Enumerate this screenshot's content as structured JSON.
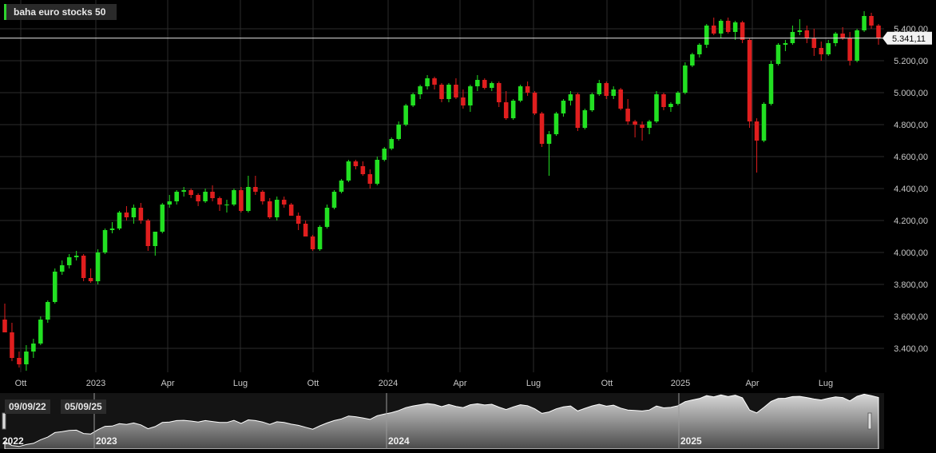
{
  "chart_data": {
    "type": "candlestick",
    "legend": "baha euro stocks 50",
    "last_price": 5341.11,
    "last_price_label": "5.341,11",
    "y_ticks": [
      "3.400,00",
      "3.600,00",
      "3.800,00",
      "4.000,00",
      "4.200,00",
      "4.400,00",
      "4.600,00",
      "4.800,00",
      "5.000,00",
      "5.200,00",
      "5.400,00"
    ],
    "x_ticks": [
      "Ott",
      "2023",
      "Apr",
      "Lug",
      "Ott",
      "2024",
      "Apr",
      "Lug",
      "Ott",
      "2025",
      "Apr",
      "Lug"
    ],
    "ylim": [
      3260,
      5460
    ],
    "colors": {
      "up": "#22e022",
      "down": "#e01e1e",
      "grid": "#2c2c2c",
      "last_line": "#e8e8e8",
      "nav_fill": "#8c8c8c"
    },
    "candles": [
      [
        3580,
        3680,
        3520,
        3500
      ],
      [
        3500,
        3560,
        3320,
        3340
      ],
      [
        3340,
        3380,
        3280,
        3300
      ],
      [
        3300,
        3420,
        3260,
        3380
      ],
      [
        3380,
        3460,
        3340,
        3430
      ],
      [
        3430,
        3600,
        3420,
        3580
      ],
      [
        3580,
        3700,
        3560,
        3690
      ],
      [
        3690,
        3900,
        3680,
        3880
      ],
      [
        3880,
        3950,
        3860,
        3920
      ],
      [
        3920,
        3990,
        3900,
        3970
      ],
      [
        3970,
        4010,
        3950,
        3980
      ],
      [
        3980,
        3990,
        3820,
        3840
      ],
      [
        3840,
        3900,
        3810,
        3820
      ],
      [
        3820,
        4020,
        3800,
        4000
      ],
      [
        4000,
        4150,
        3990,
        4140
      ],
      [
        4140,
        4190,
        4120,
        4150
      ],
      [
        4150,
        4260,
        4140,
        4250
      ],
      [
        4250,
        4290,
        4200,
        4220
      ],
      [
        4220,
        4300,
        4180,
        4280
      ],
      [
        4280,
        4310,
        4180,
        4200
      ],
      [
        4200,
        4210,
        4010,
        4040
      ],
      [
        4040,
        4130,
        3980,
        4130
      ],
      [
        4130,
        4310,
        4120,
        4300
      ],
      [
        4300,
        4360,
        4280,
        4320
      ],
      [
        4320,
        4390,
        4300,
        4380
      ],
      [
        4380,
        4410,
        4350,
        4390
      ],
      [
        4390,
        4400,
        4340,
        4360
      ],
      [
        4360,
        4370,
        4290,
        4320
      ],
      [
        4320,
        4400,
        4310,
        4380
      ],
      [
        4380,
        4420,
        4320,
        4340
      ],
      [
        4340,
        4350,
        4260,
        4300
      ],
      [
        4300,
        4330,
        4250,
        4300
      ],
      [
        4300,
        4400,
        4290,
        4390
      ],
      [
        4390,
        4410,
        4250,
        4260
      ],
      [
        4260,
        4480,
        4250,
        4410
      ],
      [
        4410,
        4480,
        4360,
        4380
      ],
      [
        4380,
        4390,
        4300,
        4320
      ],
      [
        4320,
        4340,
        4210,
        4220
      ],
      [
        4220,
        4350,
        4200,
        4330
      ],
      [
        4330,
        4350,
        4280,
        4300
      ],
      [
        4300,
        4310,
        4230,
        4230
      ],
      [
        4230,
        4250,
        4140,
        4180
      ],
      [
        4180,
        4200,
        4100,
        4100
      ],
      [
        4100,
        4110,
        4010,
        4020
      ],
      [
        4020,
        4170,
        4010,
        4160
      ],
      [
        4160,
        4300,
        4150,
        4280
      ],
      [
        4280,
        4390,
        4270,
        4380
      ],
      [
        4380,
        4460,
        4370,
        4450
      ],
      [
        4450,
        4580,
        4440,
        4570
      ],
      [
        4570,
        4580,
        4520,
        4540
      ],
      [
        4540,
        4570,
        4480,
        4490
      ],
      [
        4490,
        4520,
        4400,
        4430
      ],
      [
        4430,
        4600,
        4420,
        4580
      ],
      [
        4580,
        4660,
        4570,
        4650
      ],
      [
        4650,
        4720,
        4640,
        4710
      ],
      [
        4710,
        4820,
        4700,
        4800
      ],
      [
        4800,
        4930,
        4790,
        4920
      ],
      [
        4920,
        5000,
        4910,
        4990
      ],
      [
        4990,
        5050,
        4960,
        5040
      ],
      [
        5040,
        5110,
        5020,
        5090
      ],
      [
        5090,
        5100,
        5020,
        5050
      ],
      [
        5050,
        5060,
        4940,
        4960
      ],
      [
        4960,
        5060,
        4940,
        5050
      ],
      [
        5050,
        5090,
        4960,
        4970
      ],
      [
        4970,
        5020,
        4900,
        4920
      ],
      [
        4920,
        5050,
        4880,
        5040
      ],
      [
        5040,
        5110,
        5010,
        5080
      ],
      [
        5080,
        5090,
        5020,
        5030
      ],
      [
        5030,
        5070,
        5010,
        5060
      ],
      [
        5060,
        5070,
        4910,
        4940
      ],
      [
        4940,
        5010,
        4830,
        4840
      ],
      [
        4840,
        4960,
        4830,
        4950
      ],
      [
        4950,
        5050,
        4940,
        5040
      ],
      [
        5040,
        5070,
        4980,
        5000
      ],
      [
        5000,
        5010,
        4860,
        4870
      ],
      [
        4870,
        4880,
        4660,
        4680
      ],
      [
        4680,
        4760,
        4480,
        4740
      ],
      [
        4740,
        4880,
        4730,
        4870
      ],
      [
        4870,
        4960,
        4850,
        4950
      ],
      [
        4950,
        5010,
        4920,
        4990
      ],
      [
        4990,
        5000,
        4760,
        4780
      ],
      [
        4780,
        4900,
        4770,
        4890
      ],
      [
        4890,
        5000,
        4880,
        4990
      ],
      [
        4990,
        5080,
        4980,
        5060
      ],
      [
        5060,
        5070,
        4960,
        4980
      ],
      [
        4980,
        5040,
        4960,
        5020
      ],
      [
        5020,
        5030,
        4890,
        4900
      ],
      [
        4900,
        4960,
        4800,
        4820
      ],
      [
        4820,
        4830,
        4720,
        4800
      ],
      [
        4800,
        4820,
        4700,
        4780
      ],
      [
        4780,
        4830,
        4740,
        4820
      ],
      [
        4820,
        5010,
        4810,
        4990
      ],
      [
        4990,
        5000,
        4890,
        4910
      ],
      [
        4910,
        4940,
        4880,
        4930
      ],
      [
        4930,
        5010,
        4920,
        5000
      ],
      [
        5000,
        5190,
        4990,
        5170
      ],
      [
        5170,
        5250,
        5160,
        5240
      ],
      [
        5240,
        5310,
        5220,
        5300
      ],
      [
        5300,
        5430,
        5280,
        5420
      ],
      [
        5420,
        5470,
        5360,
        5370
      ],
      [
        5370,
        5460,
        5340,
        5450
      ],
      [
        5450,
        5470,
        5370,
        5380
      ],
      [
        5380,
        5450,
        5330,
        5440
      ],
      [
        5440,
        5450,
        5310,
        5330
      ],
      [
        5330,
        5340,
        4780,
        4820
      ],
      [
        4820,
        4840,
        4500,
        4700
      ],
      [
        4700,
        4940,
        4690,
        4930
      ],
      [
        4930,
        5200,
        4920,
        5180
      ],
      [
        5180,
        5310,
        5170,
        5300
      ],
      [
        5300,
        5330,
        5260,
        5310
      ],
      [
        5310,
        5420,
        5300,
        5380
      ],
      [
        5380,
        5460,
        5360,
        5390
      ],
      [
        5390,
        5420,
        5310,
        5340
      ],
      [
        5340,
        5400,
        5230,
        5280
      ],
      [
        5280,
        5320,
        5200,
        5240
      ],
      [
        5240,
        5330,
        5230,
        5310
      ],
      [
        5310,
        5380,
        5290,
        5370
      ],
      [
        5370,
        5410,
        5330,
        5340
      ],
      [
        5340,
        5380,
        5170,
        5200
      ],
      [
        5200,
        5400,
        5190,
        5390
      ],
      [
        5390,
        5510,
        5380,
        5480
      ],
      [
        5480,
        5500,
        5400,
        5420
      ],
      [
        5420,
        5430,
        5300,
        5341.11
      ]
    ],
    "navigator": {
      "start_label": "09/09/22",
      "end_label": "05/09/25",
      "year_labels": [
        "2022",
        "2023",
        "2024",
        "2025"
      ]
    }
  }
}
